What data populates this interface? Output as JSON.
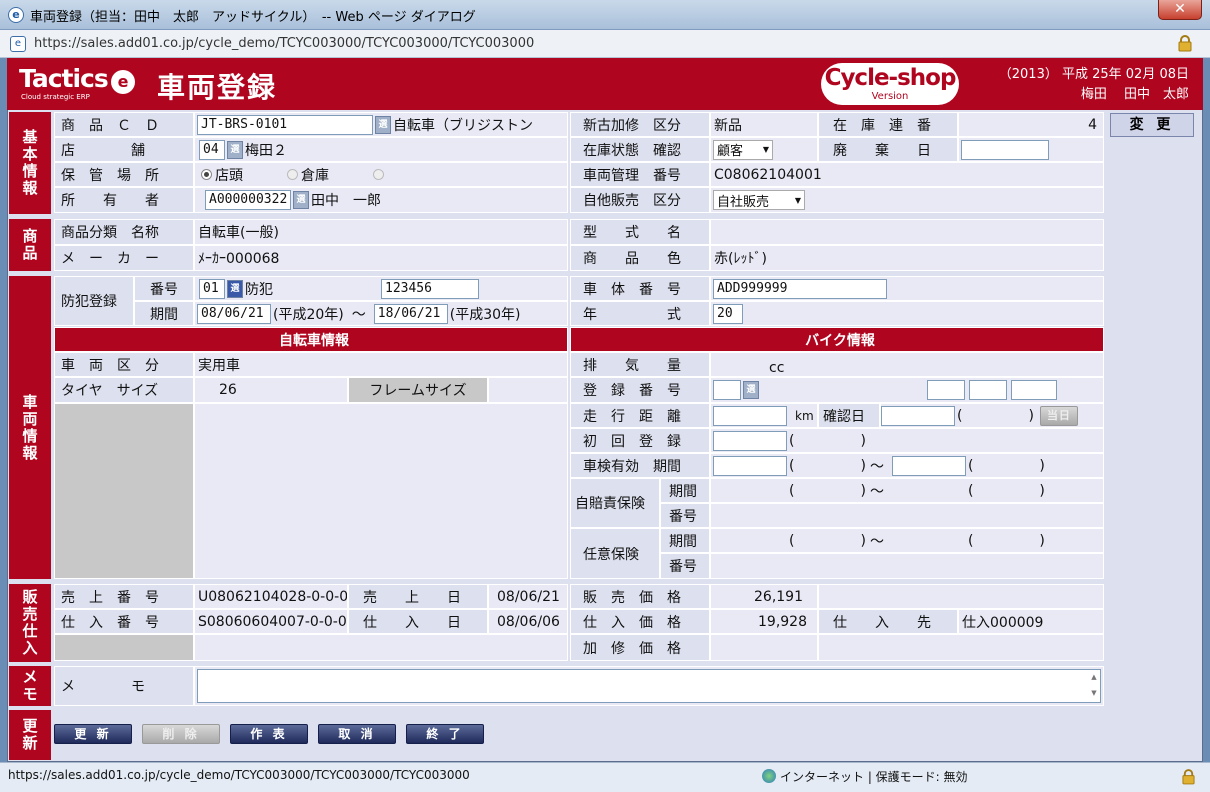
{
  "window": {
    "title": "車両登録（担当：田中　太郎　アッドサイクル）　-- Web ページ ダイアログ",
    "url": "https://sales.add01.co.jp/cycle_demo/TCYC003000/TCYC003000/TCYC003000",
    "close_label": "✕"
  },
  "header": {
    "logo_text": "Tactics",
    "logo_sub": "Cloud strategic ERP",
    "title": "車両登録",
    "badge_name": "Cycle-shop",
    "badge_version": "Version",
    "date": "（2013） 平成 25年 02月 08日",
    "user": "梅田　 田中　太郎"
  },
  "sections": {
    "basic": "基本情報",
    "product": "商品",
    "vehicle": "車両情報",
    "sales": "販売仕入",
    "memo": "メモ",
    "update": "更新"
  },
  "basic": {
    "product_cd_label": "商　品　Ｃ　Ｄ",
    "product_cd": "JT-BRS-0101",
    "product_name": "自転車（ブリジストン",
    "store_label": "店　　　　舗",
    "store_code": "04",
    "store_name": "梅田２",
    "storage_label": "保　管　場　所",
    "storage_opt1": "店頭",
    "storage_opt2": "倉庫",
    "owner_label": "所　　有　　者",
    "owner_code": "A000000322",
    "owner_name": "田中　一郎",
    "new_used_label": "新古加修　区分",
    "new_used": "新品",
    "stock_status_label": "在庫状態　確認",
    "stock_status": "顧客",
    "vehicle_mgmt_label": "車両管理　番号",
    "vehicle_mgmt": "C08062104001",
    "sales_type_label": "自他販売　区分",
    "sales_type": "自社販売",
    "stock_serial_label": "在　庫　連　番",
    "stock_serial": "4",
    "disposal_label": "廃　　棄　　日",
    "change_button": "変 更"
  },
  "product": {
    "category_label": "商品分類　名称",
    "category": "自転車(一般)",
    "maker_label": "メ　ー　カ　ー",
    "maker": "ﾒｰｶｰ000068",
    "model_label": "型　　式　　名",
    "color_label": "商　　品　　色",
    "color": "赤(ﾚｯﾄﾞ)"
  },
  "vehicle": {
    "crime_reg_label": "防犯登録",
    "number_label": "番号",
    "crime_code": "01",
    "crime_name": "防犯",
    "crime_number": "123456",
    "period_label": "期間",
    "period_from": "08/06/21",
    "period_from_era": "(平成20年)",
    "tilde": "～",
    "period_to": "18/06/21",
    "period_to_era": "(平成30年)",
    "body_number_label": "車　体　番　号",
    "body_number": "ADD999999",
    "year_label": "年　　　　　式",
    "year": "20",
    "bicycle_header": "自転車情報",
    "bike_header": "バイク情報",
    "vehicle_type_label": "車　両　区　分",
    "vehicle_type": "実用車",
    "tire_size_label": "タイヤ　サイズ",
    "tire_size": "26",
    "frame_size_label": "フレームサイズ",
    "displacement_label": "排　　気　　量",
    "displacement_unit": "cc",
    "reg_number_label": "登　録　番　号",
    "mileage_label": "走　行　距　離",
    "mileage_unit": "km",
    "confirm_date_label": "確認日",
    "paren_open": "(",
    "paren_close": ")",
    "today_button": "当日",
    "first_reg_label": "初　回　登　録",
    "inspection_label": "車検有効　期間",
    "compulsory_label": "自賠責保険",
    "voluntary_label": "任意保険",
    "ins_period_label": "期間",
    "ins_number_label": "番号"
  },
  "sales": {
    "sales_no_label": "売　上　番　号",
    "sales_no": "U08062104028-0-0-0",
    "sales_date_label": "売　　上　　日",
    "sales_date": "08/06/21",
    "sale_price_label": "販　売　価　格",
    "sale_price": "26,191",
    "purchase_no_label": "仕　入　番　号",
    "purchase_no": "S08060604007-0-0-0",
    "purchase_date_label": "仕　　入　　日",
    "purchase_date": "08/06/06",
    "purchase_price_label": "仕　入　価　格",
    "purchase_price": "19,928",
    "supplier_label": "仕　　入　　先",
    "supplier": "仕入000009",
    "repair_price_label": "加　修　価　格"
  },
  "memo": {
    "label": "メ　　　　モ",
    "value": ""
  },
  "actions": {
    "update": "更 新",
    "delete": "削 除",
    "create": "作 表",
    "cancel": "取 消",
    "end": "終 了"
  },
  "statusbar": {
    "url": "https://sales.add01.co.jp/cycle_demo/TCYC003000/TCYC003000/TCYC003000",
    "zone": "インターネット | 保護モード: 無効"
  },
  "search_glyph": "選"
}
